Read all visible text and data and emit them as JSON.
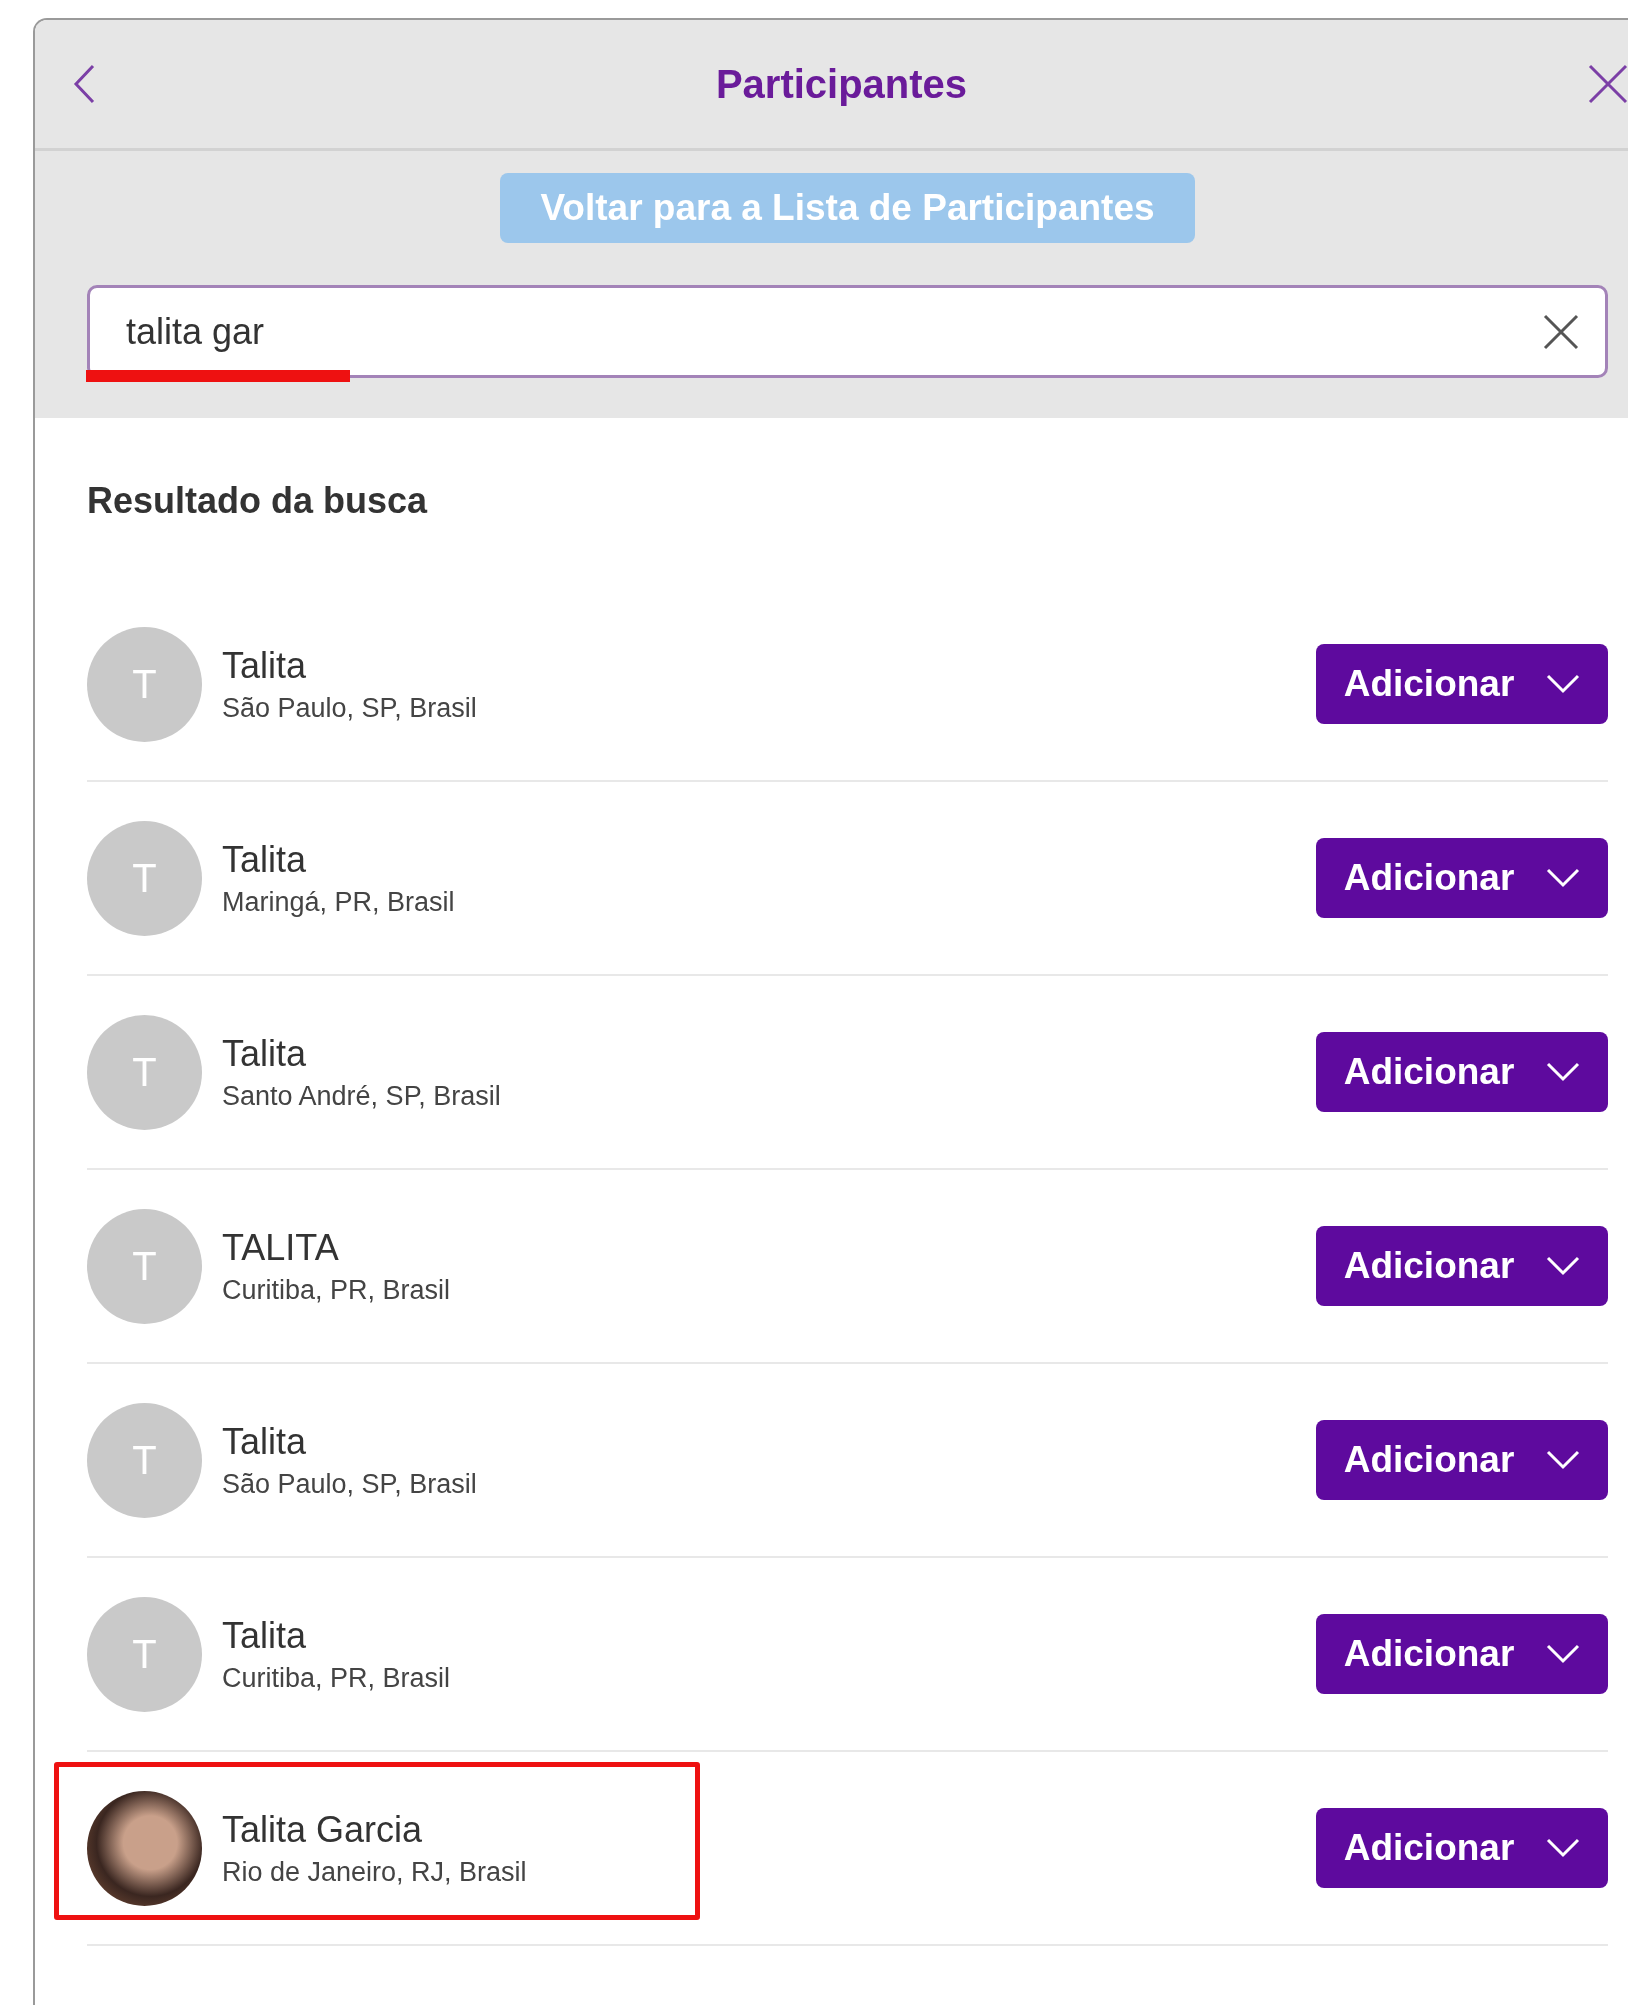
{
  "header": {
    "title": "Participantes"
  },
  "back_to_list_button": {
    "label": "Voltar para a Lista de Participantes"
  },
  "search": {
    "value": "talita gar",
    "highlighted": true
  },
  "section_title": "Resultado da busca",
  "results": [
    {
      "name": "Talita",
      "location": "São Paulo, SP, Brasil",
      "kind": "initial",
      "initial": "T",
      "action": "Adicionar",
      "highlighted": false
    },
    {
      "name": "Talita",
      "location": "Maringá, PR, Brasil",
      "kind": "initial",
      "initial": "T",
      "action": "Adicionar",
      "highlighted": false
    },
    {
      "name": "Talita",
      "location": "Santo André, SP, Brasil",
      "kind": "initial",
      "initial": "T",
      "action": "Adicionar",
      "highlighted": false
    },
    {
      "name": "TALITA",
      "location": "Curitiba, PR, Brasil",
      "kind": "initial",
      "initial": "T",
      "action": "Adicionar",
      "highlighted": false
    },
    {
      "name": "Talita",
      "location": "São Paulo, SP, Brasil",
      "kind": "initial",
      "initial": "T",
      "action": "Adicionar",
      "highlighted": false
    },
    {
      "name": "Talita",
      "location": "Curitiba, PR, Brasil",
      "kind": "initial",
      "initial": "T",
      "action": "Adicionar",
      "highlighted": false
    },
    {
      "name": "Talita Garcia",
      "location": "Rio de Janeiro, RJ, Brasil",
      "kind": "photo",
      "action": "Adicionar",
      "highlighted": true
    }
  ]
}
